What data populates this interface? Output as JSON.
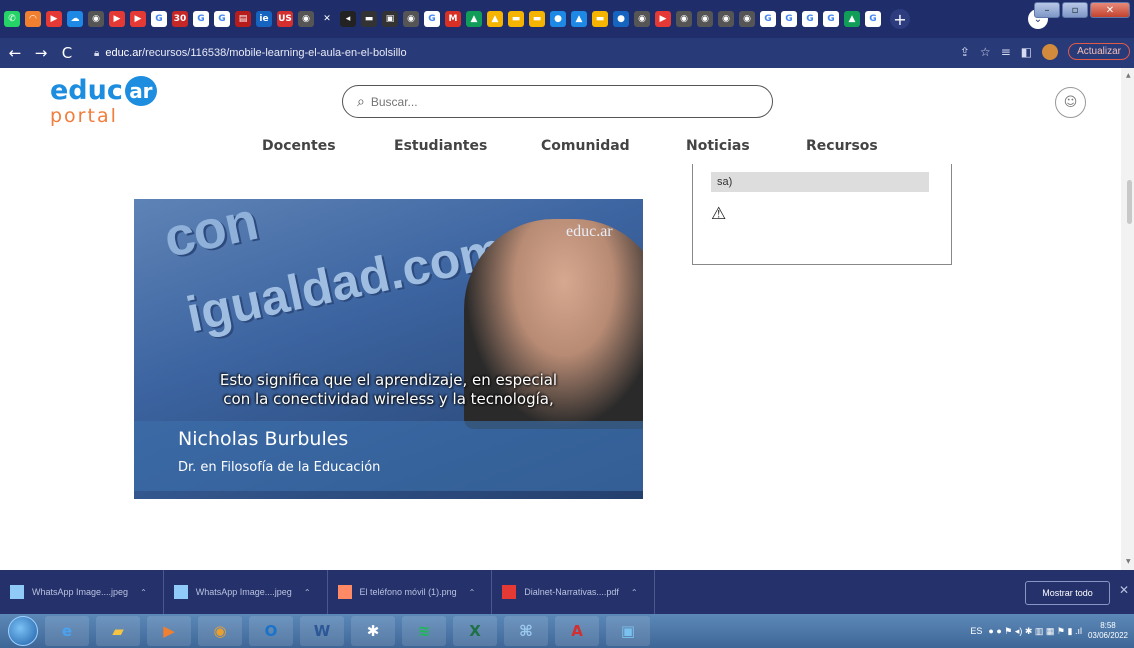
{
  "browser": {
    "tab_icons": [
      {
        "name": "whatsapp-icon",
        "color": "#25d366",
        "glyph": "✆"
      },
      {
        "name": "tab-icon-orange",
        "color": "#f08030",
        "glyph": "◠"
      },
      {
        "name": "youtube-icon",
        "color": "#e53935",
        "glyph": "▶"
      },
      {
        "name": "onedrive-icon",
        "color": "#1e88e5",
        "glyph": "☁"
      },
      {
        "name": "tab-icon-gray",
        "color": "#555",
        "glyph": "◉"
      },
      {
        "name": "youtube-icon",
        "color": "#e53935",
        "glyph": "▶"
      },
      {
        "name": "youtube-icon",
        "color": "#e53935",
        "glyph": "▶"
      },
      {
        "name": "google-icon",
        "color": "#fff",
        "glyph": "G"
      },
      {
        "name": "tab-icon-red",
        "color": "#c62828",
        "glyph": "30"
      },
      {
        "name": "google-icon",
        "color": "#fff",
        "glyph": "G"
      },
      {
        "name": "google-icon",
        "color": "#fff",
        "glyph": "G"
      },
      {
        "name": "tab-icon-red",
        "color": "#b71c1c",
        "glyph": "▤"
      },
      {
        "name": "tab-icon-blue",
        "color": "#1565c0",
        "glyph": "ie"
      },
      {
        "name": "tab-icon-red",
        "color": "#d32f2f",
        "glyph": "US"
      },
      {
        "name": "tab-icon-gray",
        "color": "#555",
        "glyph": "◉"
      },
      {
        "name": "close-icon",
        "color": "#1f2e6b",
        "glyph": "✕"
      },
      {
        "name": "tab-icon-dark",
        "color": "#222",
        "glyph": "◂"
      },
      {
        "name": "tab-icon-dark",
        "color": "#333",
        "glyph": "▬"
      },
      {
        "name": "tab-icon-dark",
        "color": "#333",
        "glyph": "▣"
      },
      {
        "name": "tab-icon-gray",
        "color": "#555",
        "glyph": "◉"
      },
      {
        "name": "google-icon",
        "color": "#fff",
        "glyph": "G"
      },
      {
        "name": "gmail-icon",
        "color": "#d93025",
        "glyph": "M"
      },
      {
        "name": "drive-icon",
        "color": "#0f9d58",
        "glyph": "▲"
      },
      {
        "name": "drive-icon",
        "color": "#f4b400",
        "glyph": "▲"
      },
      {
        "name": "slides-icon",
        "color": "#f4b400",
        "glyph": "▬"
      },
      {
        "name": "slides-icon",
        "color": "#f4b400",
        "glyph": "▬"
      },
      {
        "name": "tab-icon-blue",
        "color": "#1e88e5",
        "glyph": "●"
      },
      {
        "name": "drive-icon",
        "color": "#1e88e5",
        "glyph": "▲"
      },
      {
        "name": "slides-icon",
        "color": "#f4b400",
        "glyph": "▬"
      },
      {
        "name": "tab-icon-blue",
        "color": "#1565c0",
        "glyph": "●"
      },
      {
        "name": "tab-icon-gray",
        "color": "#555",
        "glyph": "◉"
      },
      {
        "name": "youtube-icon",
        "color": "#e53935",
        "glyph": "▶"
      },
      {
        "name": "tab-icon-gray",
        "color": "#555",
        "glyph": "◉"
      },
      {
        "name": "tab-icon-gray",
        "color": "#555",
        "glyph": "◉"
      },
      {
        "name": "tab-icon-gray",
        "color": "#555",
        "glyph": "◉"
      },
      {
        "name": "tab-icon-gray",
        "color": "#555",
        "glyph": "◉"
      },
      {
        "name": "google-icon",
        "color": "#fff",
        "glyph": "G"
      },
      {
        "name": "google-icon",
        "color": "#fff",
        "glyph": "G"
      },
      {
        "name": "google-icon",
        "color": "#fff",
        "glyph": "G"
      },
      {
        "name": "google-icon",
        "color": "#fff",
        "glyph": "G"
      },
      {
        "name": "drive-icon",
        "color": "#0f9d58",
        "glyph": "▲"
      },
      {
        "name": "google-icon",
        "color": "#fff",
        "glyph": "G"
      }
    ],
    "url_domain": "educ.ar",
    "url_path": "/recursos/116538/mobile-learning-el-aula-en-el-bolsillo",
    "update_label": "Actualizar"
  },
  "site": {
    "logo_top": "educ",
    "logo_ar": "ar",
    "logo_bottom": "portal",
    "search_placeholder": "Buscar...",
    "menu": [
      "Docentes",
      "Estudiantes",
      "Comunidad",
      "Noticias",
      "Recursos"
    ]
  },
  "video": {
    "wall_text_1": "con",
    "wall_text_2": "igualdad.com",
    "watermark": "educ.ar",
    "subtitle_line1": "Esto significa que el aprendizaje, en especial",
    "subtitle_line2": "con la conectividad wireless y la tecnología,",
    "speaker_name": "Nicholas Burbules",
    "speaker_title": "Dr. en Filosofía de la Educación"
  },
  "sidebar": {
    "pill_text": "sa)"
  },
  "downloads": {
    "items": [
      {
        "label": "WhatsApp Image....jpeg",
        "color": "#90caf9"
      },
      {
        "label": "WhatsApp Image....jpeg",
        "color": "#90caf9"
      },
      {
        "label": "El teléfono móvil (1).png",
        "color": "#ff8a65"
      },
      {
        "label": "Dialnet-Narrativas....pdf",
        "color": "#e53935"
      }
    ],
    "show_all": "Mostrar todo"
  },
  "taskbar": {
    "apps": [
      {
        "name": "ie-icon",
        "glyph": "e",
        "color": "#4aa3f0"
      },
      {
        "name": "folder-icon",
        "glyph": "▰",
        "color": "#f5c542"
      },
      {
        "name": "media-player-icon",
        "glyph": "▶",
        "color": "#f08030"
      },
      {
        "name": "chrome-icon",
        "glyph": "◉",
        "color": "#e8a030"
      },
      {
        "name": "outlook-icon",
        "glyph": "O",
        "color": "#1a73c8"
      },
      {
        "name": "word-icon",
        "glyph": "W",
        "color": "#2b5797"
      },
      {
        "name": "bluetooth-icon",
        "glyph": "✱",
        "color": "#fff"
      },
      {
        "name": "spotify-icon",
        "glyph": "≋",
        "color": "#1db954"
      },
      {
        "name": "excel-icon",
        "glyph": "X",
        "color": "#1e7145"
      },
      {
        "name": "network-icon",
        "glyph": "⌘",
        "color": "#9ecbf0"
      },
      {
        "name": "acrobat-icon",
        "glyph": "A",
        "color": "#d32f2f"
      },
      {
        "name": "photos-icon",
        "glyph": "▣",
        "color": "#7ac1f0"
      }
    ],
    "lang": "ES",
    "time": "8:58",
    "date": "03/06/2022"
  }
}
